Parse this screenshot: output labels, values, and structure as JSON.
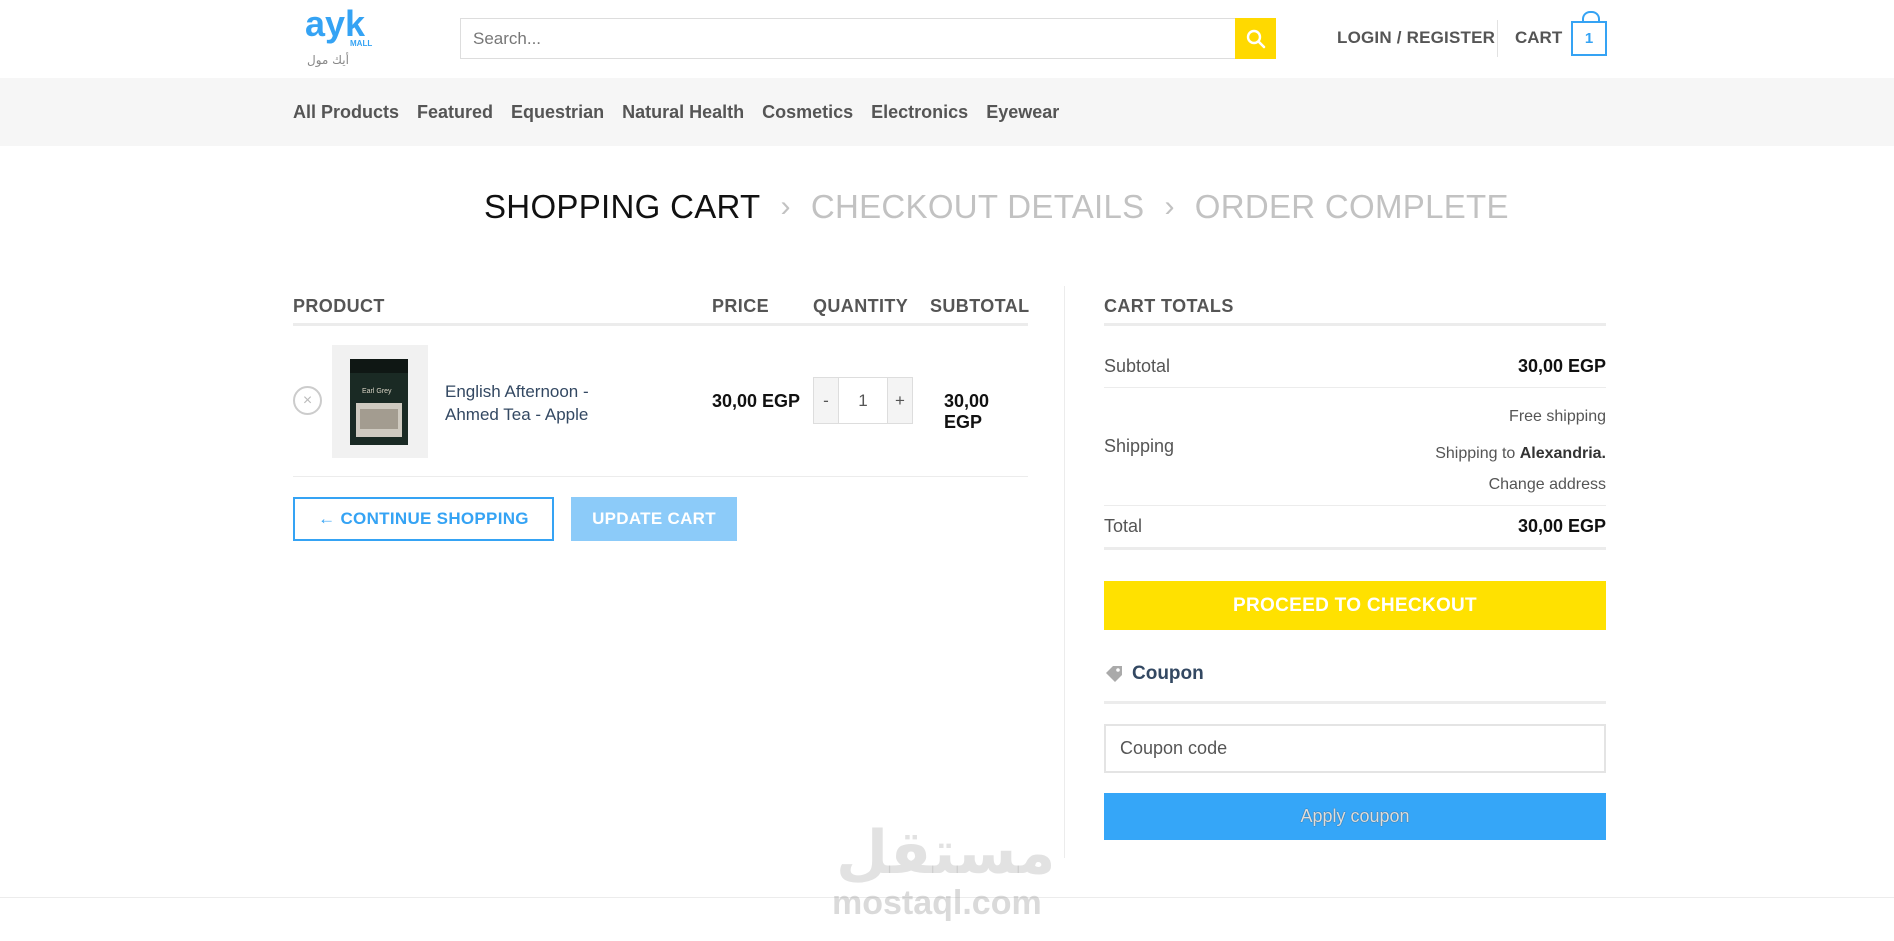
{
  "header": {
    "logo_text": "ayk",
    "logo_sub": "MALL",
    "logo_arabic": "أيك مول",
    "search_placeholder": "Search...",
    "login_label": "LOGIN / REGISTER",
    "cart_label": "CART",
    "cart_count": "1"
  },
  "nav": {
    "items": [
      "All Products",
      "Featured",
      "Equestrian",
      "Natural Health",
      "Cosmetics",
      "Electronics",
      "Eyewear"
    ]
  },
  "breadcrumb": {
    "step1": "SHOPPING CART",
    "step2": "CHECKOUT DETAILS",
    "step3": "ORDER COMPLETE"
  },
  "cart_table": {
    "headers": {
      "product": "PRODUCT",
      "price": "PRICE",
      "quantity": "QUANTITY",
      "subtotal": "SUBTOTAL"
    },
    "items": [
      {
        "remove_glyph": "×",
        "name": "English Afternoon - Ahmed Tea - Apple",
        "thumb_text": "Earl Grey",
        "price": "30,00 EGP",
        "qty_minus": "-",
        "qty": "1",
        "qty_plus": "+",
        "subtotal": "30,00 EGP"
      }
    ],
    "continue_label": "← CONTINUE SHOPPING",
    "update_label": "UPDATE CART"
  },
  "totals": {
    "title": "CART TOTALS",
    "subtotal_label": "Subtotal",
    "subtotal_value": "30,00 EGP",
    "shipping_label": "Shipping",
    "shipping_method": "Free shipping",
    "shipping_to_prefix": "Shipping to",
    "shipping_to_city": "Alexandria",
    "change_address": "Change address",
    "total_label": "Total",
    "total_value": "30,00 EGP",
    "checkout_label": "PROCEED TO CHECKOUT"
  },
  "coupon": {
    "title": "Coupon",
    "placeholder": "Coupon code",
    "apply_label": "Apply coupon"
  },
  "watermark": {
    "arabic": "مستقل",
    "latin": "mostaql.com"
  },
  "colors": {
    "accent_blue": "#35a3f4",
    "accent_yellow": "#ffd900",
    "checkout_yellow": "#ffe100"
  }
}
